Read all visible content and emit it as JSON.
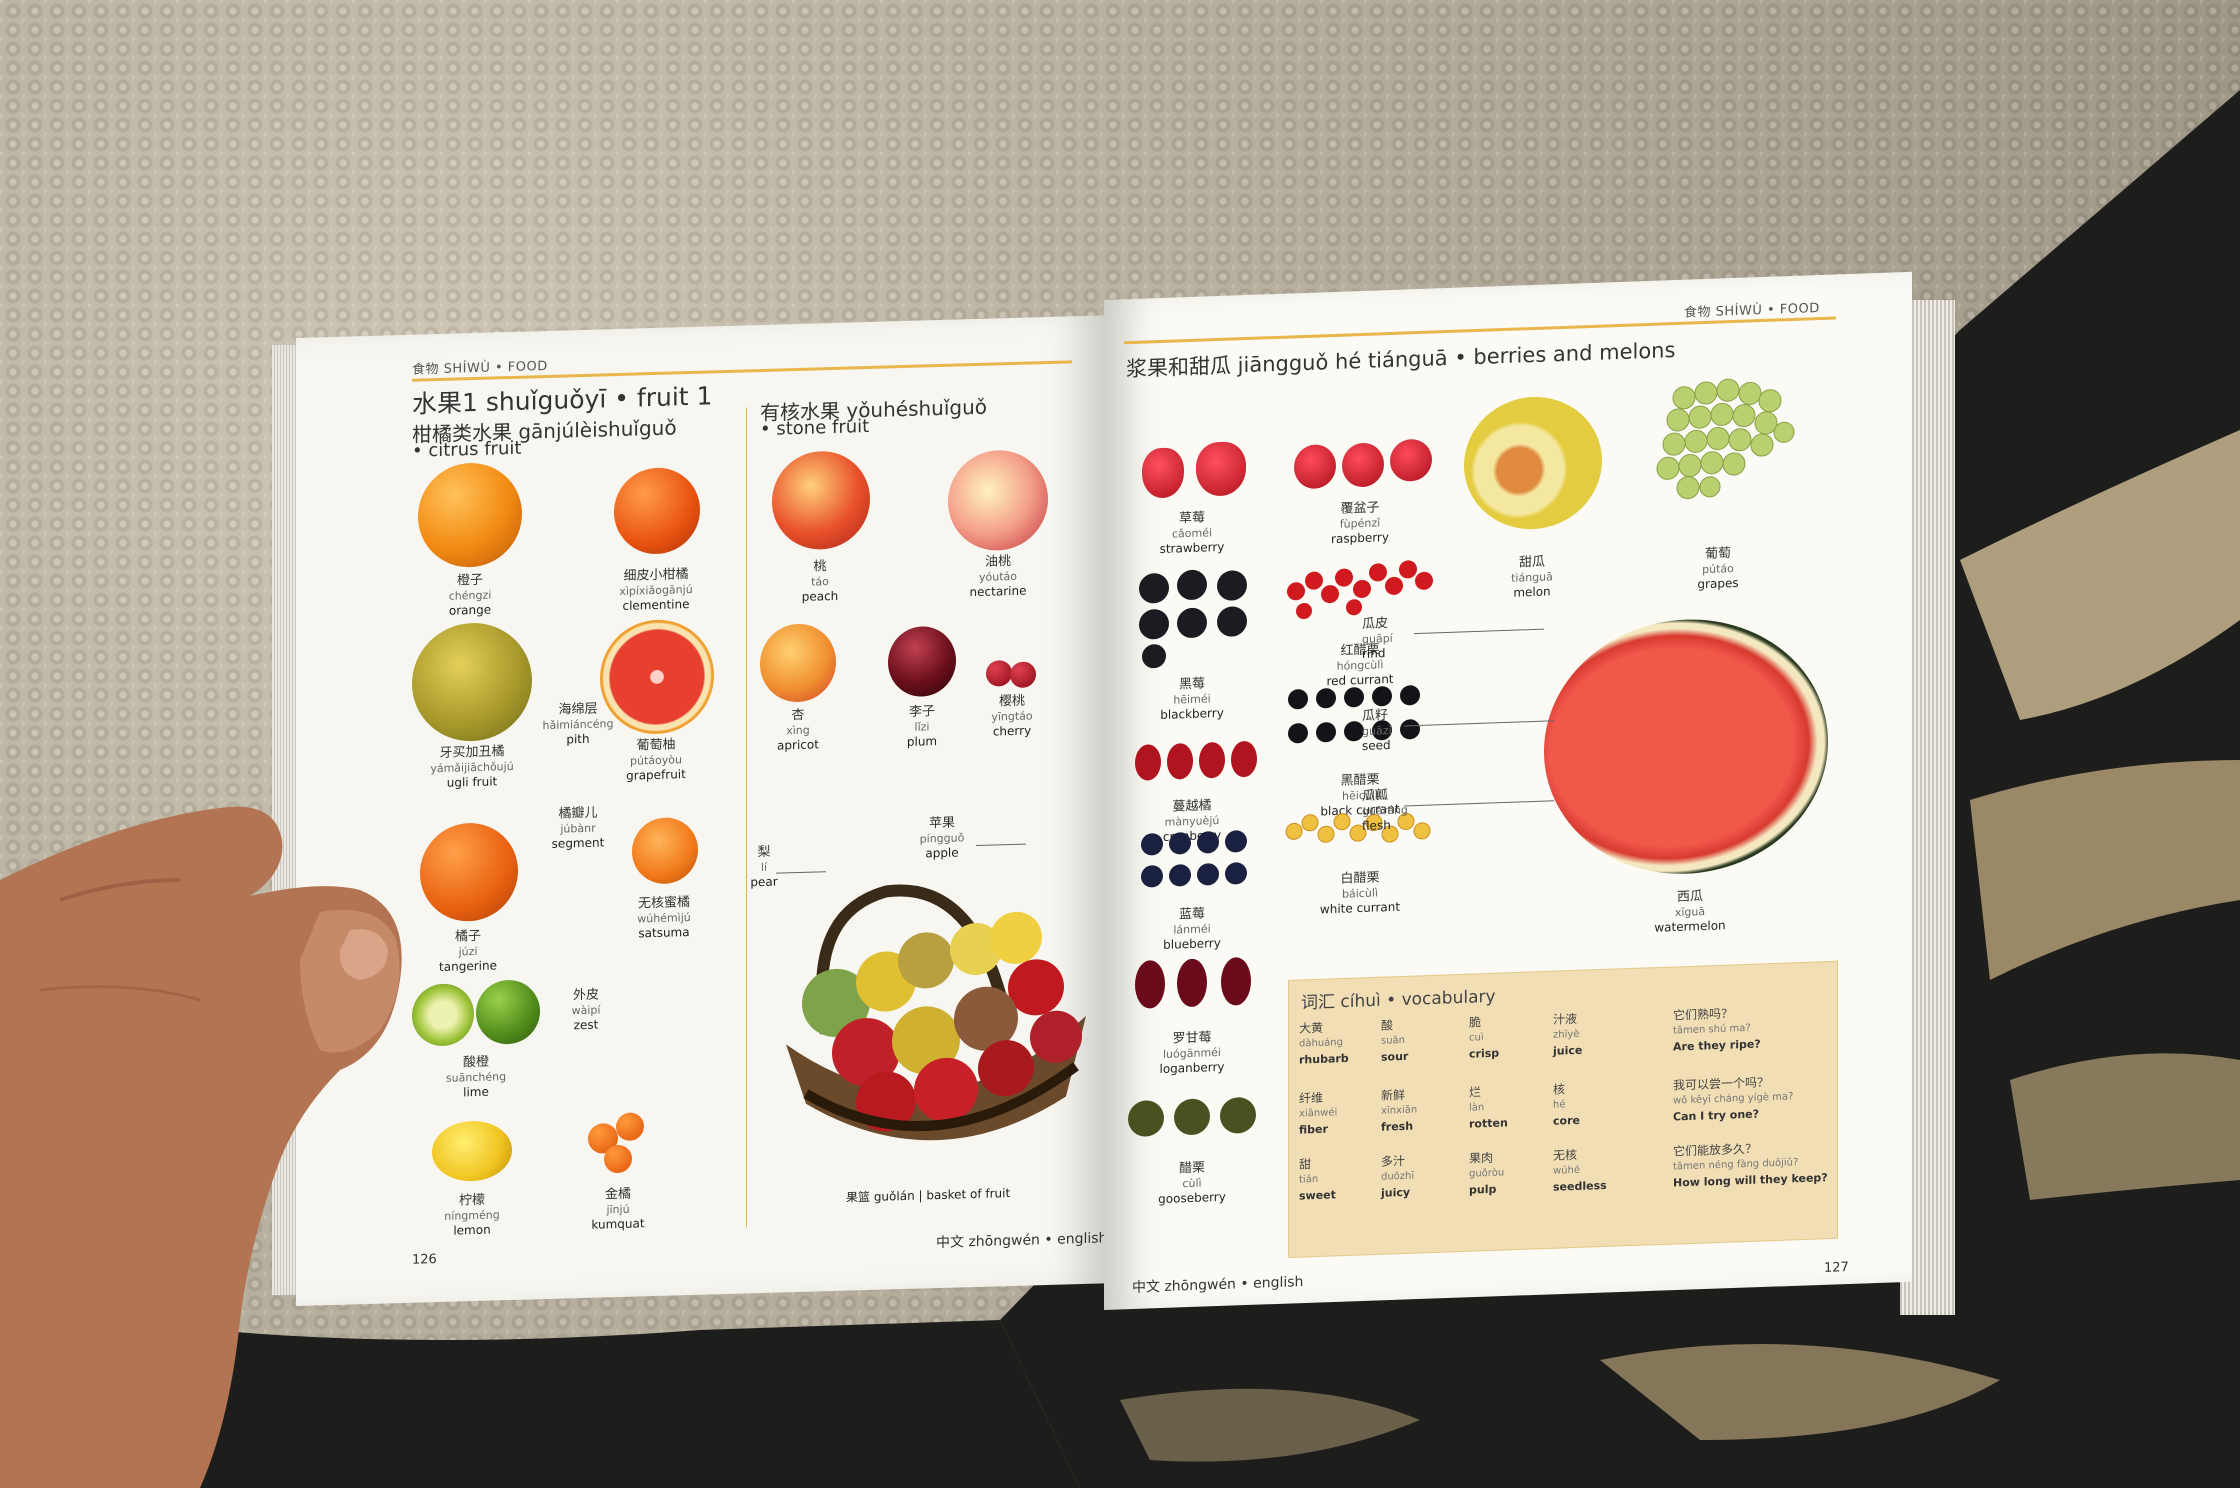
{
  "left": {
    "running_head": "食物 SHÍWÙ • FOOD",
    "title": "水果1 shuǐguǒyī • fruit 1",
    "citrus_heading_cn": "柑橘类水果 gānjúlèishuǐguǒ",
    "citrus_heading_en": "• citrus fruit",
    "stone_heading_cn": "有核水果 yǒuhéshuǐguǒ",
    "stone_heading_en": "• stone fruit",
    "page_number": "126",
    "footer": "中文 zhōngwén • english",
    "items": [
      {
        "cn": "橙子",
        "py": "chéngzi",
        "en": "orange"
      },
      {
        "cn": "细皮小柑橘",
        "py": "xìpíxiǎogānjú",
        "en": "clementine"
      },
      {
        "cn": "牙买加丑橘",
        "py": "yámǎijiāchǒujú",
        "en": "ugli fruit"
      },
      {
        "cn": "海绵层",
        "py": "hǎimiáncéng",
        "en": "pith"
      },
      {
        "cn": "葡萄柚",
        "py": "pútáoyòu",
        "en": "grapefruit"
      },
      {
        "cn": "橘瓣儿",
        "py": "júbànr",
        "en": "segment"
      },
      {
        "cn": "橘子",
        "py": "júzi",
        "en": "tangerine"
      },
      {
        "cn": "无核蜜橘",
        "py": "wúhémìjú",
        "en": "satsuma"
      },
      {
        "cn": "外皮",
        "py": "wàipí",
        "en": "zest"
      },
      {
        "cn": "酸橙",
        "py": "suānchéng",
        "en": "lime"
      },
      {
        "cn": "柠檬",
        "py": "níngméng",
        "en": "lemon"
      },
      {
        "cn": "金橘",
        "py": "jīnjú",
        "en": "kumquat"
      },
      {
        "cn": "桃",
        "py": "táo",
        "en": "peach"
      },
      {
        "cn": "油桃",
        "py": "yóutáo",
        "en": "nectarine"
      },
      {
        "cn": "杏",
        "py": "xìng",
        "en": "apricot"
      },
      {
        "cn": "李子",
        "py": "lǐzi",
        "en": "plum"
      },
      {
        "cn": "樱桃",
        "py": "yīngtáo",
        "en": "cherry"
      },
      {
        "cn": "梨",
        "py": "lí",
        "en": "pear"
      },
      {
        "cn": "苹果",
        "py": "píngguǒ",
        "en": "apple"
      }
    ],
    "basket_caption": "果篮 guǒlán | basket of fruit"
  },
  "right": {
    "running_head": "食物 SHÍWÙ • FOOD",
    "title": "浆果和甜瓜 jiāngguǒ hé tiánguā • berries and melons",
    "page_number": "127",
    "footer": "中文 zhōngwén • english",
    "items": [
      {
        "cn": "草莓",
        "py": "cǎoméi",
        "en": "strawberry"
      },
      {
        "cn": "覆盆子",
        "py": "fùpénzǐ",
        "en": "raspberry"
      },
      {
        "cn": "甜瓜",
        "py": "tiánguā",
        "en": "melon"
      },
      {
        "cn": "葡萄",
        "py": "pútáo",
        "en": "grapes"
      },
      {
        "cn": "黑莓",
        "py": "hēiméi",
        "en": "blackberry"
      },
      {
        "cn": "红醋栗",
        "py": "hóngcùlì",
        "en": "red currant"
      },
      {
        "cn": "瓜皮",
        "py": "guāpí",
        "en": "rind"
      },
      {
        "cn": "黑醋栗",
        "py": "hēicùlì",
        "en": "black currant"
      },
      {
        "cn": "瓜籽",
        "py": "guāzǐ",
        "en": "seed"
      },
      {
        "cn": "蔓越橘",
        "py": "mànyuèjú",
        "en": "cranberry"
      },
      {
        "cn": "瓜瓤",
        "py": "guāráng",
        "en": "flesh"
      },
      {
        "cn": "白醋栗",
        "py": "báicùlì",
        "en": "white currant"
      },
      {
        "cn": "蓝莓",
        "py": "lánméi",
        "en": "blueberry"
      },
      {
        "cn": "西瓜",
        "py": "xīguā",
        "en": "watermelon"
      },
      {
        "cn": "罗甘莓",
        "py": "luógānméi",
        "en": "loganberry"
      },
      {
        "cn": "醋栗",
        "py": "cùlì",
        "en": "gooseberry"
      }
    ],
    "vocab_title": "词汇 cíhuì • vocabulary",
    "vocab": [
      {
        "cn": "大黄",
        "py": "dàhuáng",
        "en": "rhubarb"
      },
      {
        "cn": "酸",
        "py": "suān",
        "en": "sour"
      },
      {
        "cn": "脆",
        "py": "cuì",
        "en": "crisp"
      },
      {
        "cn": "汁液",
        "py": "zhīyè",
        "en": "juice"
      },
      {
        "cn": "它们熟吗？",
        "py": "tāmen shú ma?",
        "en": "Are they ripe?"
      },
      {
        "cn": "纤维",
        "py": "xiānwéi",
        "en": "fiber"
      },
      {
        "cn": "新鲜",
        "py": "xīnxiān",
        "en": "fresh"
      },
      {
        "cn": "烂",
        "py": "làn",
        "en": "rotten"
      },
      {
        "cn": "核",
        "py": "hé",
        "en": "core"
      },
      {
        "cn": "我可以尝一个吗？",
        "py": "wǒ kěyǐ cháng yígè ma?",
        "en": "Can I try one?"
      },
      {
        "cn": "甜",
        "py": "tián",
        "en": "sweet"
      },
      {
        "cn": "多汁",
        "py": "duōzhī",
        "en": "juicy"
      },
      {
        "cn": "果肉",
        "py": "guǒròu",
        "en": "pulp"
      },
      {
        "cn": "无核",
        "py": "wúhé",
        "en": "seedless"
      },
      {
        "cn": "它们能放多久？",
        "py": "tāmen néng fàng duōjiǔ?",
        "en": "How long will they keep?"
      }
    ]
  },
  "colors": {
    "accent": "#e8b64a",
    "vocab_bg": "#f1deb5",
    "page": "#f8f7f1",
    "carpet": "#bdb5a3",
    "rug_dark": "#1c1d1a"
  }
}
